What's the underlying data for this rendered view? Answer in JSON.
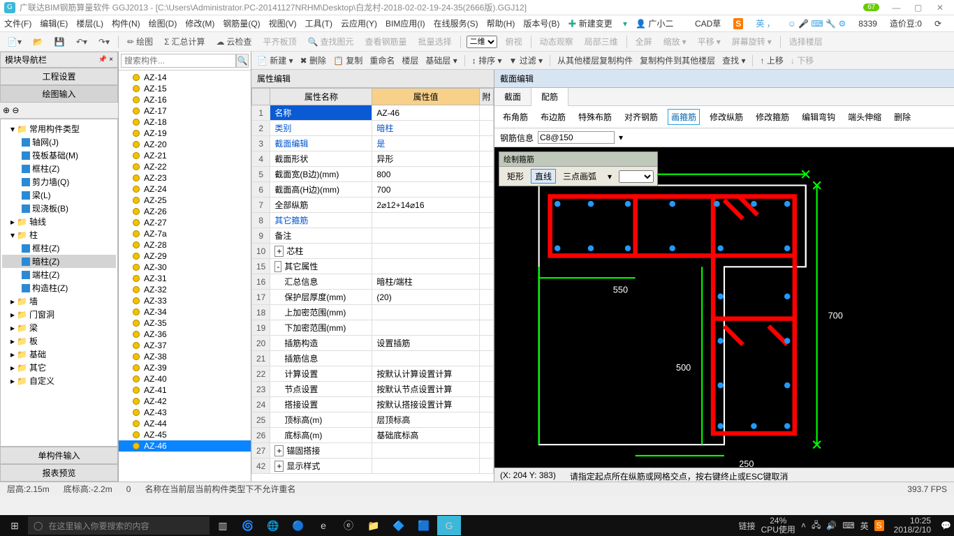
{
  "titlebar": {
    "app": "广联达BIM钢筋算量软件 GGJ2013 - [C:\\Users\\Administrator.PC-20141127NRHM\\Desktop\\白龙村-2018-02-02-19-24-35(2666版).GGJ12]",
    "badge": "67"
  },
  "menubar": {
    "items": [
      "文件(F)",
      "编辑(E)",
      "楼层(L)",
      "构件(N)",
      "绘图(D)",
      "修改(M)",
      "钢筋量(Q)",
      "视图(V)",
      "工具(T)",
      "云应用(Y)",
      "BIM应用(I)",
      "在线服务(S)",
      "帮助(H)",
      "版本号(B)"
    ],
    "newchange": "新建变更",
    "user": "广小二",
    "cad_hint": "CAD草",
    "ime_num": "8339",
    "cost_bean": "造价豆:0"
  },
  "toolbar1": {
    "items": [
      "绘图",
      "汇总计算",
      "云检查",
      "平齐板顶",
      "查找图元",
      "查看钢筋量",
      "批量选择"
    ],
    "view_combo": "二维",
    "extra": [
      "俯视",
      "动态观察",
      "局部三维",
      "全屏",
      "缩放",
      "平移",
      "屏幕旋转",
      "选择楼层"
    ]
  },
  "leftnav": {
    "header": "模块导航栏",
    "tabs": [
      "工程设置",
      "绘图输入"
    ],
    "bottom_tabs": [
      "单构件输入",
      "报表预览"
    ],
    "tree": [
      {
        "label": "常用构件类型",
        "lvl": 0,
        "open": true,
        "fld": true
      },
      {
        "label": "轴网(J)",
        "lvl": 1
      },
      {
        "label": "筏板基础(M)",
        "lvl": 1
      },
      {
        "label": "框柱(Z)",
        "lvl": 1
      },
      {
        "label": "剪力墙(Q)",
        "lvl": 1
      },
      {
        "label": "梁(L)",
        "lvl": 1
      },
      {
        "label": "现浇板(B)",
        "lvl": 1
      },
      {
        "label": "轴线",
        "lvl": 0,
        "fld": true
      },
      {
        "label": "柱",
        "lvl": 0,
        "open": true,
        "fld": true
      },
      {
        "label": "框柱(Z)",
        "lvl": 1
      },
      {
        "label": "暗柱(Z)",
        "lvl": 1,
        "sel": true
      },
      {
        "label": "端柱(Z)",
        "lvl": 1
      },
      {
        "label": "构造柱(Z)",
        "lvl": 1
      },
      {
        "label": "墙",
        "lvl": 0,
        "fld": true
      },
      {
        "label": "门窗洞",
        "lvl": 0,
        "fld": true
      },
      {
        "label": "梁",
        "lvl": 0,
        "fld": true
      },
      {
        "label": "板",
        "lvl": 0,
        "fld": true
      },
      {
        "label": "基础",
        "lvl": 0,
        "fld": true
      },
      {
        "label": "其它",
        "lvl": 0,
        "fld": true
      },
      {
        "label": "自定义",
        "lvl": 0,
        "fld": true
      }
    ]
  },
  "complist": {
    "toolbar": [
      "新建",
      "删除",
      "复制",
      "重命名",
      "楼层",
      "基础层"
    ],
    "search_ph": "搜索构件...",
    "items": [
      "AZ-14",
      "AZ-15",
      "AZ-16",
      "AZ-17",
      "AZ-18",
      "AZ-19",
      "AZ-20",
      "AZ-21",
      "AZ-22",
      "AZ-23",
      "AZ-24",
      "AZ-25",
      "AZ-26",
      "AZ-27",
      "AZ-7a",
      "AZ-28",
      "AZ-29",
      "AZ-30",
      "AZ-31",
      "AZ-32",
      "AZ-33",
      "AZ-34",
      "AZ-35",
      "AZ-36",
      "AZ-37",
      "AZ-38",
      "AZ-39",
      "AZ-40",
      "AZ-41",
      "AZ-42",
      "AZ-43",
      "AZ-44",
      "AZ-45",
      "AZ-46"
    ],
    "selected": "AZ-46"
  },
  "secondary_tb": {
    "items": [
      "排序",
      "过滤",
      "从其他楼层复制构件",
      "复制构件到其他楼层",
      "查找",
      "上移",
      "下移"
    ]
  },
  "property": {
    "title": "属性编辑",
    "col_name": "属性名称",
    "col_value": "属性值",
    "col_extra": "附",
    "rows": [
      {
        "n": "1",
        "name": "名称",
        "val": "AZ-46",
        "sel": true
      },
      {
        "n": "2",
        "name": "类别",
        "val": "暗柱",
        "hl": true
      },
      {
        "n": "3",
        "name": "截面编辑",
        "val": "是",
        "hl": true
      },
      {
        "n": "4",
        "name": "截面形状",
        "val": "异形"
      },
      {
        "n": "5",
        "name": "截面宽(B边)(mm)",
        "val": "800"
      },
      {
        "n": "6",
        "name": "截面高(H边)(mm)",
        "val": "700"
      },
      {
        "n": "7",
        "name": "全部纵筋",
        "val": "2⌀12+14⌀16"
      },
      {
        "n": "8",
        "name": "其它箍筋",
        "val": "",
        "hl": true
      },
      {
        "n": "9",
        "name": "备注",
        "val": ""
      },
      {
        "n": "10",
        "name": "芯柱",
        "val": "",
        "exp": "+"
      },
      {
        "n": "15",
        "name": "其它属性",
        "val": "",
        "exp": "-"
      },
      {
        "n": "16",
        "name": "汇总信息",
        "val": "暗柱/端柱",
        "ind": true
      },
      {
        "n": "17",
        "name": "保护层厚度(mm)",
        "val": "(20)",
        "ind": true
      },
      {
        "n": "18",
        "name": "上加密范围(mm)",
        "val": "",
        "ind": true
      },
      {
        "n": "19",
        "name": "下加密范围(mm)",
        "val": "",
        "ind": true
      },
      {
        "n": "20",
        "name": "插筋构造",
        "val": "设置插筋",
        "ind": true
      },
      {
        "n": "21",
        "name": "插筋信息",
        "val": "",
        "ind": true
      },
      {
        "n": "22",
        "name": "计算设置",
        "val": "按默认计算设置计算",
        "ind": true
      },
      {
        "n": "23",
        "name": "节点设置",
        "val": "按默认节点设置计算",
        "ind": true
      },
      {
        "n": "24",
        "name": "搭接设置",
        "val": "按默认搭接设置计算",
        "ind": true
      },
      {
        "n": "25",
        "name": "顶标高(m)",
        "val": "层顶标高",
        "ind": true
      },
      {
        "n": "26",
        "name": "底标高(m)",
        "val": "基础底标高",
        "ind": true
      },
      {
        "n": "27",
        "name": "锚固搭接",
        "val": "",
        "exp": "+"
      },
      {
        "n": "42",
        "name": "显示样式",
        "val": "",
        "exp": "+"
      }
    ]
  },
  "section": {
    "title": "截面编辑",
    "tabs": [
      "截面",
      "配筋"
    ],
    "active_tab": "配筋",
    "sub_items": [
      "布角筋",
      "布边筋",
      "特殊布筋",
      "对齐钢筋",
      "画箍筋",
      "修改纵筋",
      "修改箍筋",
      "编辑弯钩",
      "端头伸缩",
      "删除"
    ],
    "sub_active": "画箍筋",
    "rebar_label": "钢筋信息",
    "rebar_value": "C8@150",
    "float_title": "绘制箍筋",
    "float_items": [
      "矩形",
      "直线",
      "三点画弧"
    ],
    "float_active": "直线",
    "dims": {
      "w1": "550",
      "h1": "700",
      "h2": "500",
      "w2": "250"
    },
    "coord": "(X: 204 Y: 383)",
    "hint": "请指定起点所在纵筋或网格交点，按右键终止或ESC键取消"
  },
  "appstatus": {
    "floor": "层高:2.15m",
    "bottom": "底标高:-2.2m",
    "zero": "0",
    "msg": "名称在当前层当前构件类型下不允许重名",
    "fps": "393.7 FPS"
  },
  "taskbar": {
    "search_ph": "在这里输入你要搜索的内容",
    "link": "链接",
    "cpu_pct": "24%",
    "cpu_lbl": "CPU使用",
    "ime": "英",
    "time": "10:25",
    "date": "2018/2/10"
  }
}
